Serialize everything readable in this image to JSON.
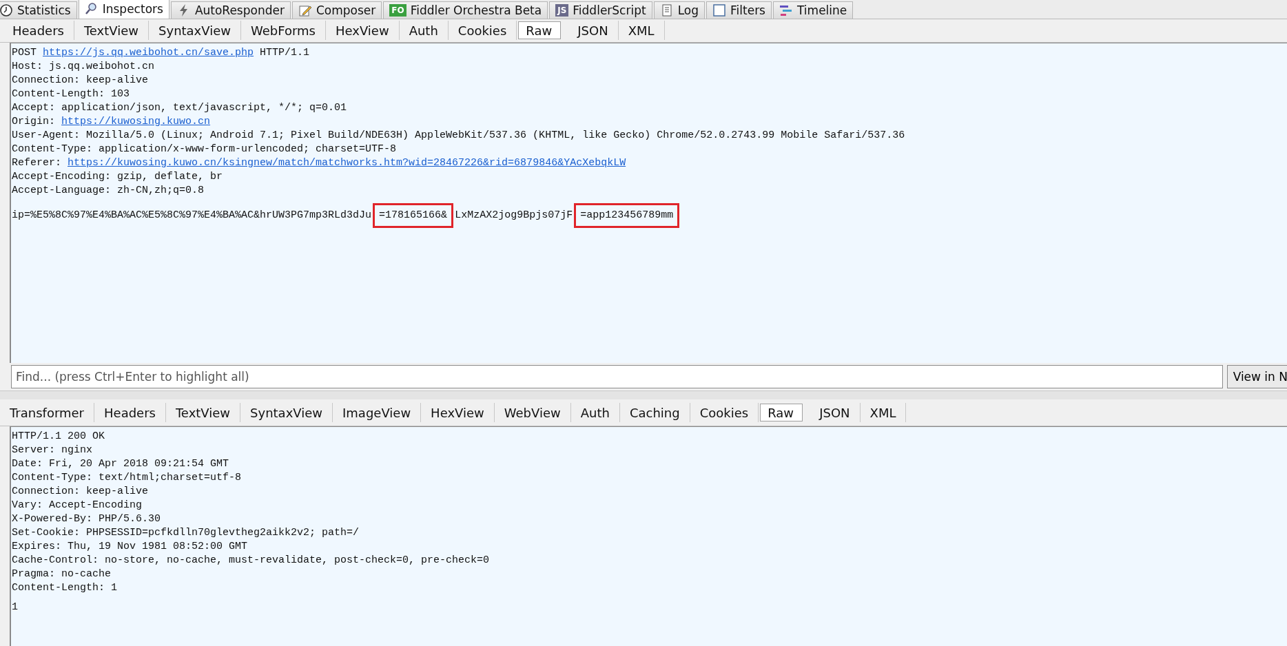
{
  "main_tabs": [
    {
      "label": "Statistics",
      "selected": false
    },
    {
      "label": "Inspectors",
      "selected": true
    },
    {
      "label": "AutoResponder",
      "selected": false
    },
    {
      "label": "Composer",
      "selected": false
    },
    {
      "label": "Fiddler Orchestra Beta",
      "badge": "FO",
      "selected": false
    },
    {
      "label": "FiddlerScript",
      "badge": "JS",
      "selected": false
    },
    {
      "label": "Log",
      "selected": false
    },
    {
      "label": "Filters",
      "selected": false
    },
    {
      "label": "Timeline",
      "selected": false
    }
  ],
  "request": {
    "tabs": [
      {
        "label": "Headers",
        "selected": false
      },
      {
        "label": "TextView",
        "selected": false
      },
      {
        "label": "SyntaxView",
        "selected": false
      },
      {
        "label": "WebForms",
        "selected": false
      },
      {
        "label": "HexView",
        "selected": false
      },
      {
        "label": "Auth",
        "selected": false
      },
      {
        "label": "Cookies",
        "selected": false
      },
      {
        "label": "Raw",
        "selected": true
      },
      {
        "label": "JSON",
        "selected": false
      },
      {
        "label": "XML",
        "selected": false
      }
    ],
    "headers": [
      {
        "segments": [
          {
            "kind": "text",
            "text": "POST "
          },
          {
            "kind": "link",
            "text": "https://js.qq.weibohot.cn/save.php"
          },
          {
            "kind": "text",
            "text": " HTTP/1.1"
          }
        ]
      },
      {
        "segments": [
          {
            "kind": "text",
            "text": "Host: js.qq.weibohot.cn"
          }
        ]
      },
      {
        "segments": [
          {
            "kind": "text",
            "text": "Connection: keep-alive"
          }
        ]
      },
      {
        "segments": [
          {
            "kind": "text",
            "text": "Content-Length: 103"
          }
        ]
      },
      {
        "segments": [
          {
            "kind": "text",
            "text": "Accept: application/json, text/javascript, */*; q=0.01"
          }
        ]
      },
      {
        "segments": [
          {
            "kind": "text",
            "text": "Origin: "
          },
          {
            "kind": "link",
            "text": "https://kuwosing.kuwo.cn"
          }
        ]
      },
      {
        "segments": [
          {
            "kind": "text",
            "text": "User-Agent: Mozilla/5.0 (Linux; Android 7.1; Pixel Build/NDE63H) AppleWebKit/537.36 (KHTML, like Gecko) Chrome/52.0.2743.99 Mobile Safari/537.36"
          }
        ]
      },
      {
        "segments": [
          {
            "kind": "text",
            "text": "Content-Type: application/x-www-form-urlencoded; charset=UTF-8"
          }
        ]
      },
      {
        "segments": [
          {
            "kind": "text",
            "text": "Referer: "
          },
          {
            "kind": "link",
            "text": "https://kuwosing.kuwo.cn/ksingnew/match/matchworks.htm?wid=28467226&rid=6879846&YAcXebqkLW"
          }
        ]
      },
      {
        "segments": [
          {
            "kind": "text",
            "text": "Accept-Encoding: gzip, deflate, br"
          }
        ]
      },
      {
        "segments": [
          {
            "kind": "text",
            "text": "Accept-Language: zh-CN,zh;q=0.8"
          }
        ]
      }
    ],
    "body": [
      {
        "segments": [
          {
            "kind": "text",
            "text": "ip=%E5%8C%97%E4%BA%AC%E5%8C%97%E4%BA%AC&hrUW3PG7mp3RLd3dJu"
          },
          {
            "kind": "mark",
            "text": "=178165166&"
          },
          {
            "kind": "text",
            "text": "LxMzAX2jog9Bpjs07jF"
          },
          {
            "kind": "mark",
            "text": "=app123456789mm"
          }
        ]
      }
    ],
    "find": {
      "placeholder": "Find... (press Ctrl+Enter to highlight all)",
      "button": "View in N"
    }
  },
  "response": {
    "tabs": [
      {
        "label": "Transformer",
        "selected": false
      },
      {
        "label": "Headers",
        "selected": false
      },
      {
        "label": "TextView",
        "selected": false
      },
      {
        "label": "SyntaxView",
        "selected": false
      },
      {
        "label": "ImageView",
        "selected": false
      },
      {
        "label": "HexView",
        "selected": false
      },
      {
        "label": "WebView",
        "selected": false
      },
      {
        "label": "Auth",
        "selected": false
      },
      {
        "label": "Caching",
        "selected": false
      },
      {
        "label": "Cookies",
        "selected": false
      },
      {
        "label": "Raw",
        "selected": true
      },
      {
        "label": "JSON",
        "selected": false
      },
      {
        "label": "XML",
        "selected": false
      }
    ],
    "headers": [
      {
        "segments": [
          {
            "kind": "text",
            "text": "HTTP/1.1 200 OK"
          }
        ]
      },
      {
        "segments": [
          {
            "kind": "text",
            "text": "Server: nginx"
          }
        ]
      },
      {
        "segments": [
          {
            "kind": "text",
            "text": "Date: Fri, 20 Apr 2018 09:21:54 GMT"
          }
        ]
      },
      {
        "segments": [
          {
            "kind": "text",
            "text": "Content-Type: text/html;charset=utf-8"
          }
        ]
      },
      {
        "segments": [
          {
            "kind": "text",
            "text": "Connection: keep-alive"
          }
        ]
      },
      {
        "segments": [
          {
            "kind": "text",
            "text": "Vary: Accept-Encoding"
          }
        ]
      },
      {
        "segments": [
          {
            "kind": "text",
            "text": "X-Powered-By: PHP/5.6.30"
          }
        ]
      },
      {
        "segments": [
          {
            "kind": "text",
            "text": "Set-Cookie: PHPSESSID=pcfkdlln70glevtheg2aikk2v2; path=/"
          }
        ]
      },
      {
        "segments": [
          {
            "kind": "text",
            "text": "Expires: Thu, 19 Nov 1981 08:52:00 GMT"
          }
        ]
      },
      {
        "segments": [
          {
            "kind": "text",
            "text": "Cache-Control: no-store, no-cache, must-revalidate, post-check=0, pre-check=0"
          }
        ]
      },
      {
        "segments": [
          {
            "kind": "text",
            "text": "Pragma: no-cache"
          }
        ]
      },
      {
        "segments": [
          {
            "kind": "text",
            "text": "Content-Length: 1"
          }
        ]
      }
    ],
    "body": [
      {
        "segments": [
          {
            "kind": "text",
            "text": "1"
          }
        ]
      }
    ]
  }
}
